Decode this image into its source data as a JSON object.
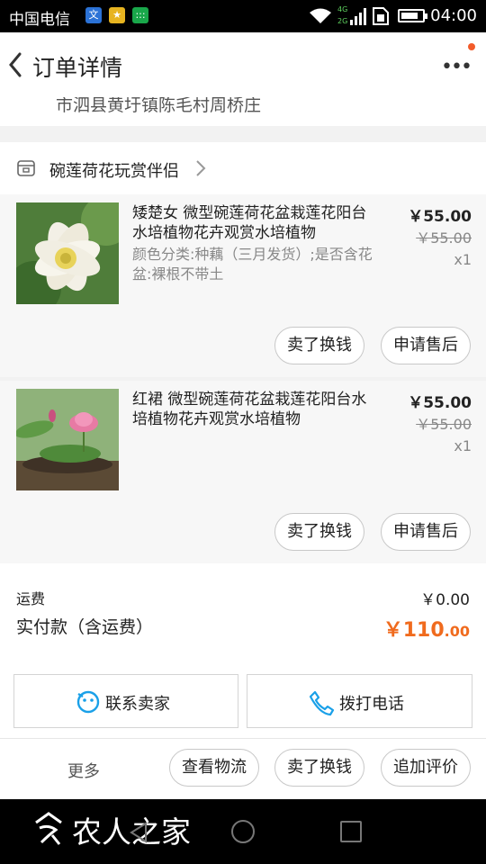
{
  "status_bar": {
    "carrier": "中国电信",
    "network_small": "4G",
    "network_small_2": "2G",
    "time": "04:00",
    "battery_level": 0.8
  },
  "nav": {
    "title": "订单详情",
    "more_label": "•••"
  },
  "address": {
    "partial_line": "市泗县黄圩镇陈毛村周桥庄"
  },
  "shop": {
    "name": "碗莲荷花玩赏伴侣"
  },
  "items": [
    {
      "title": "矮楚女  微型碗莲荷花盆栽莲花阳台水培植物花卉观赏水培植物",
      "attributes": "颜色分类:种藕（三月发货）;是否含花盆:裸根不带土",
      "price": "￥55.00",
      "original_price": "￥55.00",
      "quantity": "x1",
      "buttons": {
        "sell": "卖了换钱",
        "after_sale": "申请售后"
      }
    },
    {
      "title": "红裙 微型碗莲荷花盆栽莲花阳台水培植物花卉观赏水培植物",
      "attributes": "",
      "price": "￥55.00",
      "original_price": "￥55.00",
      "quantity": "x1",
      "buttons": {
        "sell": "卖了换钱",
        "after_sale": "申请售后"
      }
    }
  ],
  "summary": {
    "freight_label": "运费",
    "freight_value": "￥0.00",
    "total_label": "实付款（含运费）",
    "total_int": "￥110",
    "total_cents": ".00"
  },
  "contact": {
    "seller_label": "联系卖家",
    "call_label": "拨打电话"
  },
  "actions": {
    "more_label": "更多",
    "logistics": "查看物流",
    "sell": "卖了换钱",
    "review": "追加评价"
  },
  "watermark": {
    "text": "农人之家"
  },
  "colors": {
    "accent": "#f06b1e",
    "link_blue": "#1aa0e8"
  }
}
